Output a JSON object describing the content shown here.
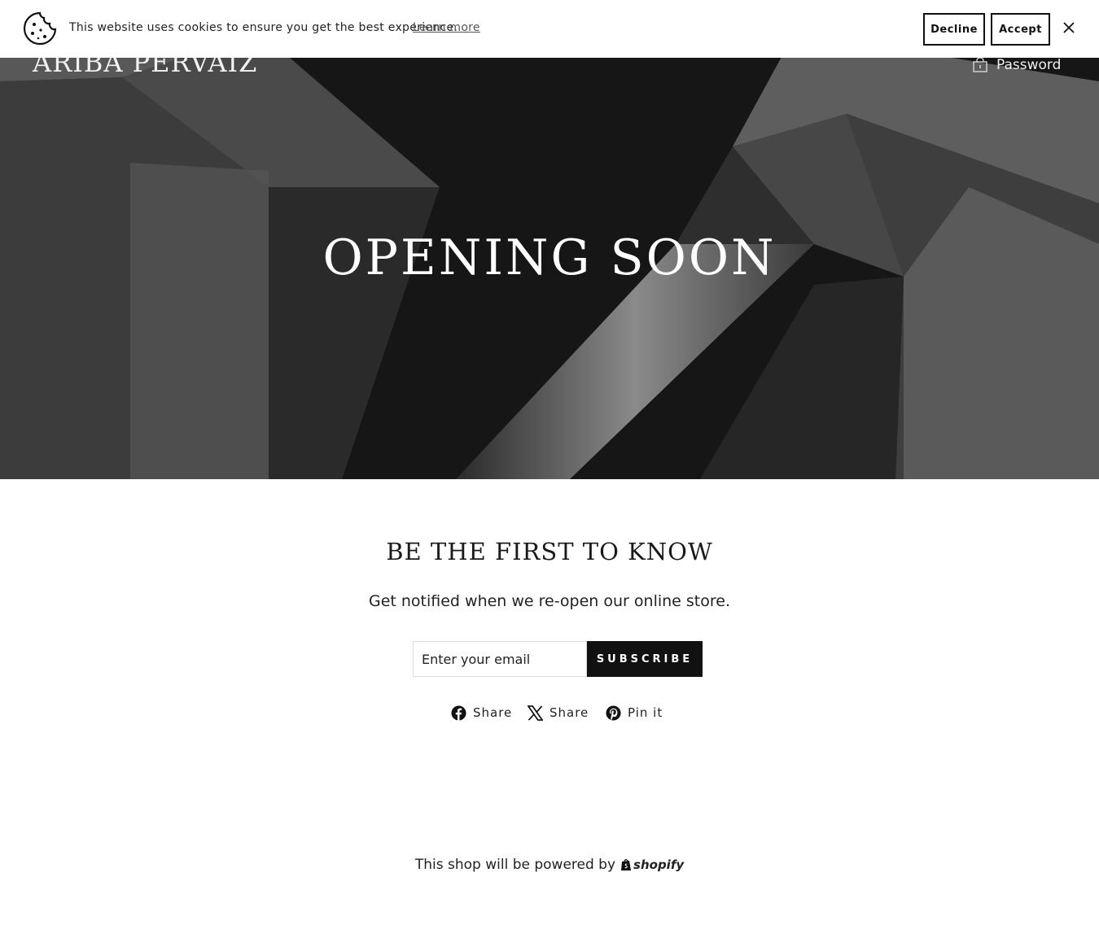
{
  "cookie_bar": {
    "message": "This website uses cookies to ensure you get the best experience.",
    "learn_more": "Learn more",
    "decline": "Decline",
    "accept": "Accept"
  },
  "header": {
    "brand": "ARIBA PERVAIZ",
    "password_link": "Password"
  },
  "hero": {
    "title": "OPENING SOON"
  },
  "signup": {
    "heading": "BE THE FIRST TO KNOW",
    "subheading": "Get notified when we re-open our online store.",
    "email_placeholder": "Enter your email",
    "subscribe": "SUBSCRIBE"
  },
  "social": {
    "facebook": "Share",
    "twitter": "Share",
    "pinterest": "Pin it"
  },
  "footer": {
    "powered_by": "This shop will be powered by",
    "shopify": "shopify"
  }
}
